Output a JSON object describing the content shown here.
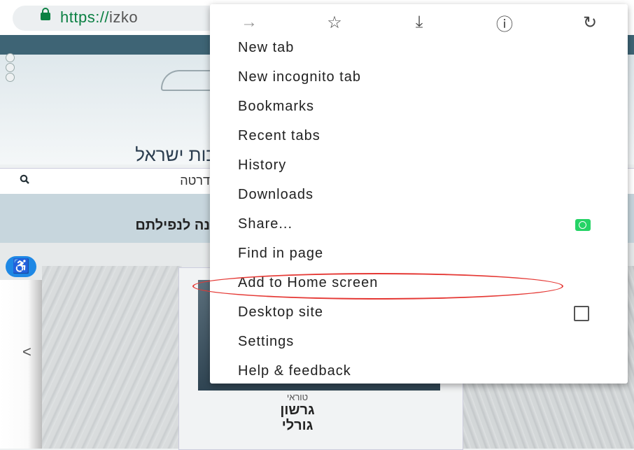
{
  "browser": {
    "url_scheme": "https://",
    "url_host": "izko"
  },
  "page": {
    "site_title": "כות ישראל",
    "search_text": "דרטה",
    "band_text": "נה לנפילתם",
    "card_caption_small": "טוראי",
    "card_caption_line1": "גרשון",
    "card_caption_line2": "גורלי",
    "prev_arrow": "<"
  },
  "menu": {
    "toolbar": [
      {
        "name": "forward-icon",
        "glyph": "→"
      },
      {
        "name": "bookmark-star-icon",
        "glyph": "☆"
      },
      {
        "name": "download-icon",
        "glyph": "⤓"
      },
      {
        "name": "page-info-icon",
        "glyph": "ⓘ"
      },
      {
        "name": "reload-icon",
        "glyph": "↻"
      }
    ],
    "items": [
      {
        "label": "New tab"
      },
      {
        "label": "New incognito tab"
      },
      {
        "label": "Bookmarks"
      },
      {
        "label": "Recent tabs"
      },
      {
        "label": "History"
      },
      {
        "label": "Downloads"
      },
      {
        "label": "Share...",
        "trailing_icon": "whatsapp-icon"
      },
      {
        "label": "Find in page"
      },
      {
        "label": "Add to Home screen",
        "highlighted": true
      },
      {
        "label": "Desktop site",
        "checkbox": false
      },
      {
        "label": "Settings"
      },
      {
        "label": "Help & feedback"
      }
    ]
  },
  "colors": {
    "accent_green": "#0b8043",
    "highlight_red": "#e53935",
    "whatsapp_green": "#25d366"
  }
}
